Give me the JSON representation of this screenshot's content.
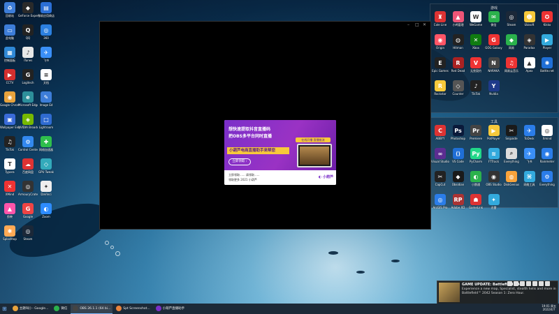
{
  "desktop_left": [
    {
      "label": "回收站",
      "icon": "recycle-bin-icon",
      "color": "#3d7dd8",
      "glyph": "♻"
    },
    {
      "label": "GeForce Experience",
      "icon": "nvidia-icon",
      "color": "#2a2a2a",
      "glyph": "◆"
    },
    {
      "label": "微软应用商店",
      "icon": "store-icon",
      "color": "#2b6fd6",
      "glyph": "▤"
    },
    {
      "label": "此电脑",
      "icon": "computer-icon",
      "color": "#3d7dd8",
      "glyph": "▭"
    },
    {
      "label": "QQ",
      "icon": "qq-icon",
      "color": "#222",
      "glyph": "Q"
    },
    {
      "label": "360",
      "icon": "app-icon",
      "color": "#2c80e0",
      "glyph": "◎"
    },
    {
      "label": "控制面板",
      "icon": "control-panel-icon",
      "color": "#2f88d6",
      "glyph": "▦"
    },
    {
      "label": "iTunes",
      "icon": "itunes-icon",
      "color": "#e8e8e8",
      "glyph": "♪"
    },
    {
      "label": "飞书",
      "icon": "feishu-icon",
      "color": "#3a8ff7",
      "glyph": "✈"
    },
    {
      "label": "CCTV",
      "icon": "tv-icon",
      "color": "#d32f2f",
      "glyph": "▶"
    },
    {
      "label": "Logitech",
      "icon": "logitech-icon",
      "color": "#222",
      "glyph": "G"
    },
    {
      "label": "文档",
      "icon": "doc-icon",
      "color": "#ffffff",
      "glyph": "≡"
    },
    {
      "label": "Google Chrome",
      "icon": "chrome-icon",
      "color": "#e8a33d",
      "glyph": "◉"
    },
    {
      "label": "Microsoft Edge",
      "icon": "edge-icon",
      "color": "#2d8f9a",
      "glyph": "e"
    },
    {
      "label": "Image Ed",
      "icon": "image-icon",
      "color": "#3d7dd8",
      "glyph": "✎"
    },
    {
      "label": "Wallpaper Engine",
      "icon": "wallpaper-icon",
      "color": "#3a6bd8",
      "glyph": "▣"
    },
    {
      "label": "NVIDIA Broadcast",
      "icon": "broadcast-icon",
      "color": "#76b900",
      "glyph": "◈"
    },
    {
      "label": "Lightroom",
      "icon": "folder-icon",
      "color": "#2f6bd1",
      "glyph": "□"
    },
    {
      "label": "TikTok",
      "icon": "tiktok-icon",
      "color": "#222",
      "glyph": "♫"
    },
    {
      "label": "Control Center",
      "icon": "control-icon",
      "color": "#3388ee",
      "glyph": "⚙"
    },
    {
      "label": "网络加速器",
      "icon": "network-icon",
      "color": "#2fbf4c",
      "glyph": "✚"
    },
    {
      "label": "Typora",
      "icon": "typora-icon",
      "color": "#ffffff",
      "glyph": "T"
    },
    {
      "label": "百度网盘",
      "icon": "cloud-icon",
      "color": "#d33",
      "glyph": "☁"
    },
    {
      "label": "GPU Tweak",
      "icon": "gpu-icon",
      "color": "#3ab",
      "glyph": "◇"
    },
    {
      "label": "XMind",
      "icon": "xmind-icon",
      "color": "#e33",
      "glyph": "✕"
    },
    {
      "label": "ArmouryCrate",
      "icon": "armoury-icon",
      "color": "#333",
      "glyph": "◎"
    },
    {
      "label": "DaVinci",
      "icon": "davinci-icon",
      "color": "#eee",
      "glyph": "✦"
    },
    {
      "label": "剪映",
      "icon": "capcut-icon",
      "color": "#f5a",
      "glyph": "▲"
    },
    {
      "label": "Google",
      "icon": "google-icon",
      "color": "#e44",
      "glyph": "G"
    },
    {
      "label": "Zoom",
      "icon": "zoom-icon",
      "color": "#2d8cff",
      "glyph": "◐"
    },
    {
      "label": "Splashtop",
      "icon": "splash-icon",
      "color": "#fa5",
      "glyph": "✱"
    },
    {
      "label": "Steam",
      "icon": "steam-icon",
      "color": "#1b2838",
      "glyph": "◎"
    }
  ],
  "fence_top": {
    "title": "游戏",
    "items": [
      {
        "label": "Cole Line",
        "icon": "game-icon",
        "color": "#d33",
        "glyph": "♜"
      },
      {
        "label": "小鸡管理",
        "icon": "chicken-icon",
        "color": "#e57",
        "glyph": "▲"
      },
      {
        "label": "WeGame",
        "icon": "wegame-icon",
        "color": "#fff",
        "glyph": "W"
      },
      {
        "label": "微信",
        "icon": "wechat-icon",
        "color": "#2bb24c",
        "glyph": "✉"
      },
      {
        "label": "Steam",
        "icon": "steam-icon",
        "color": "#1b2838",
        "glyph": "◎"
      },
      {
        "label": "Ubisoft",
        "icon": "ubisoft-icon",
        "color": "#f7c93b",
        "glyph": "☻"
      },
      {
        "label": "Kikko",
        "icon": "game-icon",
        "color": "#e33",
        "glyph": "✪"
      },
      {
        "label": "Origin",
        "icon": "origin-icon",
        "color": "#f56",
        "glyph": "◉"
      },
      {
        "label": "Hitman",
        "icon": "hitman-icon",
        "color": "#222",
        "glyph": "◍"
      },
      {
        "label": "Xbox",
        "icon": "xbox-icon",
        "color": "#107c10",
        "glyph": "✕"
      },
      {
        "label": "GOG Galaxy",
        "icon": "gog-icon",
        "color": "#e33",
        "glyph": "G"
      },
      {
        "label": "网易",
        "icon": "netease-icon",
        "color": "#2bb24c",
        "glyph": "◆"
      },
      {
        "label": "Paradox",
        "icon": "game-icon",
        "color": "#333",
        "glyph": "◈"
      },
      {
        "label": "Player",
        "icon": "play-icon",
        "color": "#3ad",
        "glyph": "▶"
      },
      {
        "label": "Epic Games",
        "icon": "epic-icon",
        "color": "#222",
        "glyph": "E"
      },
      {
        "label": "Red Dead",
        "icon": "rdr-icon",
        "color": "#a22",
        "glyph": "R"
      },
      {
        "label": "无畏契约",
        "icon": "valorant-icon",
        "color": "#e33",
        "glyph": "V"
      },
      {
        "label": "NARAKA",
        "icon": "naraka-icon",
        "color": "#444",
        "glyph": "N"
      },
      {
        "label": "网易云音乐",
        "icon": "music-icon",
        "color": "#e33",
        "glyph": "♫"
      },
      {
        "label": "Apex",
        "icon": "apex-icon",
        "color": "#fff",
        "glyph": "▲"
      },
      {
        "label": "Battle.net",
        "icon": "battlenet-icon",
        "color": "#1f6fd6",
        "glyph": "✺"
      },
      {
        "label": "Rockstar",
        "icon": "rockstar-icon",
        "color": "#f7c93b",
        "glyph": "R"
      },
      {
        "label": "Counter",
        "icon": "game-icon",
        "color": "#555",
        "glyph": "◇"
      },
      {
        "label": "TikTok",
        "icon": "tiktok-icon",
        "color": "#222",
        "glyph": "♪"
      },
      {
        "label": "Nvidia",
        "icon": "nvidia-icon",
        "color": "#1f3a8a",
        "glyph": "Y"
      }
    ]
  },
  "fence_bottom": {
    "title": "工具",
    "items": [
      {
        "label": "ABBYY",
        "icon": "abbyy-icon",
        "color": "#d33",
        "glyph": "C"
      },
      {
        "label": "Photoshop",
        "icon": "photoshop-icon",
        "color": "#0a1a3a",
        "glyph": "Ps"
      },
      {
        "label": "Premiere",
        "icon": "premiere-icon",
        "color": "#444",
        "glyph": "Pr"
      },
      {
        "label": "PotPlayer",
        "icon": "potplayer-icon",
        "color": "#f7c93b",
        "glyph": "▶"
      },
      {
        "label": "Snipaste",
        "icon": "snip-icon",
        "color": "#1a1a1a",
        "glyph": "✂"
      },
      {
        "label": "ToDesk",
        "icon": "todesk-icon",
        "color": "#2b7de9",
        "glyph": "✈"
      },
      {
        "label": "Xmind",
        "icon": "xmind-icon",
        "color": "#fff",
        "glyph": "◎"
      },
      {
        "label": "Visual Studio",
        "icon": "vs-icon",
        "color": "#5c2d91",
        "glyph": "∞"
      },
      {
        "label": "VS Code",
        "icon": "vscode-icon",
        "color": "#1f6fd6",
        "glyph": "⟨⟩"
      },
      {
        "label": "PyCharm",
        "icon": "pycharm-icon",
        "color": "#21d789",
        "glyph": "Py"
      },
      {
        "label": "FTTrack",
        "icon": "app-icon",
        "color": "#3ad",
        "glyph": "≋"
      },
      {
        "label": "Everything",
        "icon": "search-icon",
        "color": "#ddd",
        "glyph": "⌕"
      },
      {
        "label": "飞书",
        "icon": "feishu-icon",
        "color": "#3a8ff7",
        "glyph": "✈"
      },
      {
        "label": "Rainmeter",
        "icon": "rain-icon",
        "color": "#2b7de9",
        "glyph": "◉"
      },
      {
        "label": "CapCut",
        "icon": "capcut-icon",
        "color": "#222",
        "glyph": "✂"
      },
      {
        "label": "Obsidian",
        "icon": "obsidian-icon",
        "color": "#1a1a1a",
        "glyph": "◆"
      },
      {
        "label": "小鹅通",
        "icon": "goose-icon",
        "color": "#2bb24c",
        "glyph": "◐"
      },
      {
        "label": "OBS Studio",
        "icon": "obs-icon",
        "color": "#333",
        "glyph": "◉"
      },
      {
        "label": "DiskGenius",
        "icon": "disk-icon",
        "color": "#f7a33b",
        "glyph": "◍"
      },
      {
        "label": "网络工具",
        "icon": "tool-icon",
        "color": "#3ad",
        "glyph": "⌘"
      },
      {
        "label": "Everything",
        "icon": "app-icon",
        "color": "#2b7de9",
        "glyph": "⚙"
      },
      {
        "label": "ArcGIS Pro",
        "icon": "arcgis-icon",
        "color": "#2b7de9",
        "glyph": "◎"
      },
      {
        "label": "Adobe XD",
        "icon": "xd-icon",
        "color": "#a33",
        "glyph": "RP"
      },
      {
        "label": "GameLink",
        "icon": "gamelink-icon",
        "color": "#d33",
        "glyph": "☗"
      },
      {
        "label": "迅雷",
        "icon": "thunder-icon",
        "color": "#3ad",
        "glyph": "✦"
      }
    ]
  },
  "video_window": {
    "min": "–",
    "max": "□",
    "close": "✕"
  },
  "ad": {
    "headline1": "想快速提取抖音直播码",
    "headline2": "把OBS多平台同时直播",
    "yellow": "小葫芦电商直播助手来帮您",
    "button": "立即领取 ›",
    "tag": "在线开播 直播推流",
    "line1": "立即领取...... 请领取......",
    "line2": "领取更多 2021 小葫芦",
    "logo": "◐ 小葫芦"
  },
  "notification": {
    "title": "GAME UPDATE: Battlefield 2042",
    "body": "Experience a new map, Specialist, stealth helis and more in Battlefield™ 2042 Season 1: Zero Hour."
  },
  "taskbar": [
    {
      "label": "主題叫() - Google...",
      "color": "#e8a33d"
    },
    {
      "label": "微信",
      "color": "#2bb24c"
    },
    {
      "label": "OBS 26.1.1 (64 bi...",
      "color": "#444",
      "active": true
    },
    {
      "label": "Spt Screenshot...",
      "color": "#e8833d"
    },
    {
      "label": "小葫芦直播助手",
      "color": "#7a2fc9"
    }
  ],
  "clock": {
    "time": "19:01 周五",
    "date": "2022/4/7"
  }
}
